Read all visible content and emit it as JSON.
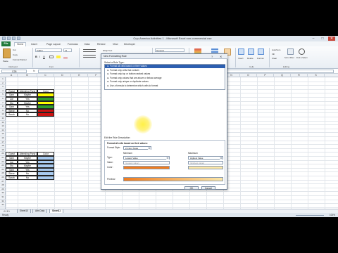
{
  "window": {
    "title": "Cup-America Activities 1 - Microsoft Excel non-commercial use",
    "min": "–",
    "max": "□",
    "close": "✕"
  },
  "menu": {
    "file": "File",
    "tabs": [
      "Home",
      "Insert",
      "Page Layout",
      "Formulas",
      "Data",
      "Review",
      "View",
      "Developer"
    ]
  },
  "ribbon": {
    "clipboard": {
      "label": "Clipboard",
      "cut": "Cut",
      "copy": "Copy",
      "paste_label": "Paste",
      "format_painter": "Format Painter"
    },
    "font": {
      "label": "Font",
      "name": "Calibri",
      "size": "11"
    },
    "alignment": {
      "label": "Alignment",
      "wrap": "Wrap Text",
      "merge": "Merge & Center"
    },
    "number": {
      "label": "Number",
      "format": "General"
    },
    "styles": {
      "label": "Styles",
      "cond": "Conditional Formatting",
      "table": "Format as Table",
      "cell": "Cell Styles"
    },
    "cells": {
      "label": "Cells",
      "insert": "Insert",
      "delete": "Delete",
      "format": "Format"
    },
    "editing": {
      "label": "Editing",
      "autosum": "AutoSum",
      "fill": "Fill",
      "clear": "Clear",
      "sort": "Sort & Filter",
      "find": "Find & Select"
    }
  },
  "formula_bar": {
    "name_box": "C28",
    "fx": "fx",
    "value": ""
  },
  "columns": [
    "A",
    "B",
    "C",
    "D",
    "E",
    "F",
    "G",
    "H",
    "I",
    "J",
    "K",
    "L",
    "M",
    "N",
    "O",
    "P",
    "Q",
    "R",
    "S"
  ],
  "rows": [
    "1",
    "2",
    "3",
    "4",
    "5",
    "6",
    "7",
    "8",
    "9",
    "10",
    "11",
    "12",
    "13",
    "14",
    "15",
    "16",
    "17",
    "18",
    "19",
    "20",
    "21",
    "22",
    "23",
    "24",
    "25",
    "26",
    "27",
    "28",
    "29",
    "30",
    "31",
    "32",
    "33"
  ],
  "table_top": {
    "headers": [
      "Guest",
      "Attending Party",
      "Color"
    ],
    "rows": [
      {
        "guest": "Sam",
        "party": "Maybe",
        "color": "#ffff00"
      },
      {
        "guest": "Joe",
        "party": "Yes",
        "color": "#2f9e2f"
      },
      {
        "guest": "Stu",
        "party": "Maybe",
        "color": "#ffff00"
      },
      {
        "guest": "Sam",
        "party": "Yes",
        "color": "#2f9e2f"
      },
      {
        "guest": "Steve",
        "party": "No",
        "color": "#cc1111"
      },
      {
        "guest": "Sarah",
        "party": "No",
        "color": "#cc1111"
      }
    ]
  },
  "table_bottom": {
    "headers": [
      "Guest",
      "Attending Party",
      "Color"
    ],
    "rows": [
      {
        "guest": "Sam",
        "party": "Maybe"
      },
      {
        "guest": "Joe",
        "party": "Yes"
      },
      {
        "guest": "Stu",
        "party": "Maybe"
      },
      {
        "guest": "Sam",
        "party": "Yes"
      },
      {
        "guest": "Steve",
        "party": "No"
      },
      {
        "guest": "Sarah",
        "party": "No"
      }
    ]
  },
  "dialog": {
    "title": "New Formatting Rule",
    "help": "?",
    "close": "✕",
    "select_label": "Select a Rule Type:",
    "rules": [
      "► Format all cells based on their values",
      "► Format only cells that contain",
      "► Format only top or bottom ranked values",
      "► Format only values that are above or below average",
      "► Format only unique or duplicate values",
      "► Use a formula to determine which cells to format"
    ],
    "edit_label": "Edit the Rule Description:",
    "format_heading": "Format all cells based on their values:",
    "format_style_label": "Format Style:",
    "format_style": "2-Color Scale",
    "minimum": "Minimum",
    "maximum": "Maximum",
    "type_label": "Type:",
    "value_label": "Value:",
    "color_label": "Color:",
    "min_type": "Lowest Value",
    "max_type": "Highest Value",
    "min_value": "(Lowest value)",
    "max_value": "(Highest value)",
    "min_color": "#f07c1e",
    "max_color": "#fbe6a8",
    "preview_label": "Preview:",
    "ok": "OK",
    "cancel": "Cancel"
  },
  "sheets": [
    "Sheet10",
    "Attn Data",
    "Sheet11"
  ],
  "status": {
    "ready": "Ready",
    "zoom": "100%"
  }
}
